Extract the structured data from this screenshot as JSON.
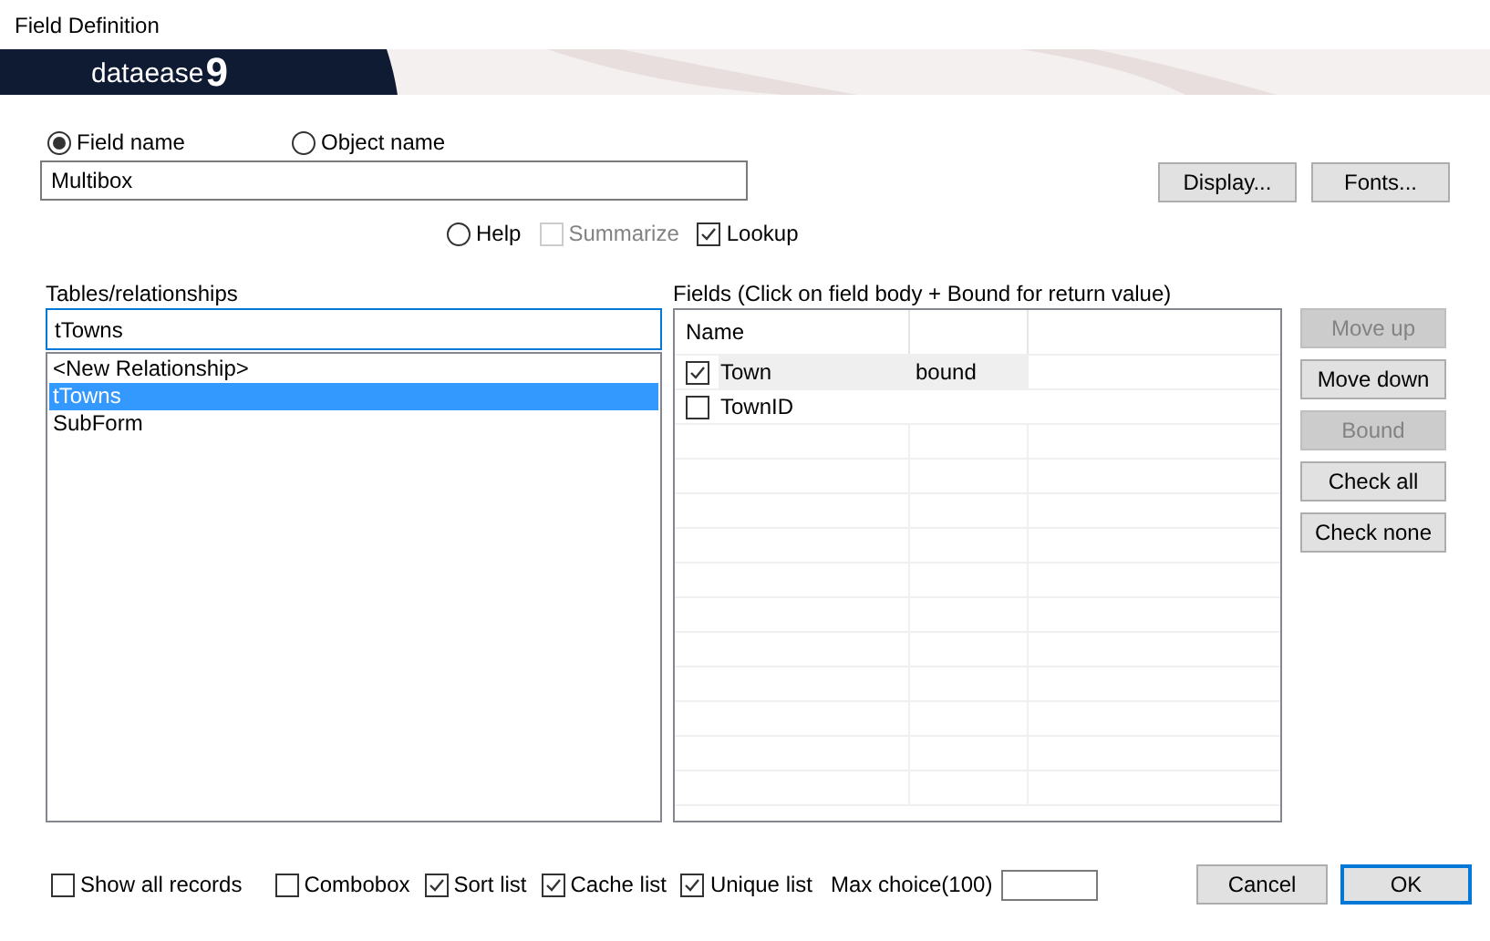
{
  "window": {
    "title": "Field Definition"
  },
  "banner": {
    "logo_text": "dataease",
    "logo_version": "9"
  },
  "name_type": [
    {
      "label": "Field name",
      "selected": true
    },
    {
      "label": "Object name",
      "selected": false
    }
  ],
  "name_field": {
    "value": "Multibox"
  },
  "top_buttons": [
    {
      "label": "Display..."
    },
    {
      "label": "Fonts..."
    }
  ],
  "options": [
    {
      "kind": "radio",
      "label": "Help",
      "selected": false
    },
    {
      "kind": "checkbox",
      "label": "Summarize",
      "checked": false,
      "disabled": true
    },
    {
      "kind": "checkbox",
      "label": "Lookup",
      "checked": true,
      "disabled": false
    }
  ],
  "tables": {
    "label": "Tables/relationships",
    "value": "tTowns",
    "items": [
      {
        "label": "<New Relationship>",
        "selected": false
      },
      {
        "label": "tTowns",
        "selected": true
      },
      {
        "label": "SubForm",
        "selected": false
      }
    ]
  },
  "fields": {
    "label": "Fields (Click on field body + Bound for return value)",
    "columns": [
      "Name"
    ],
    "rows": [
      {
        "name": "Town",
        "checked": true,
        "bound": "bound",
        "selected": true
      },
      {
        "name": "TownID",
        "checked": false,
        "selected": false
      }
    ]
  },
  "side_buttons": [
    {
      "label": "Move up",
      "disabled": true
    },
    {
      "label": "Move down",
      "disabled": false
    },
    {
      "label": "Bound",
      "disabled": true
    },
    {
      "label": "Check all",
      "disabled": false
    },
    {
      "label": "Check none",
      "disabled": false
    }
  ],
  "bottom_options": [
    {
      "label": "Show all records",
      "checked": false
    },
    {
      "label": "Combobox",
      "checked": false
    },
    {
      "label": "Sort list",
      "checked": true
    },
    {
      "label": "Cache list",
      "checked": true
    },
    {
      "label": "Unique list",
      "checked": true
    }
  ],
  "max_choice": {
    "label": "Max choice(100)"
  },
  "dialog_buttons": [
    {
      "label": "Cancel",
      "default": false
    },
    {
      "label": "OK",
      "default": true
    }
  ]
}
